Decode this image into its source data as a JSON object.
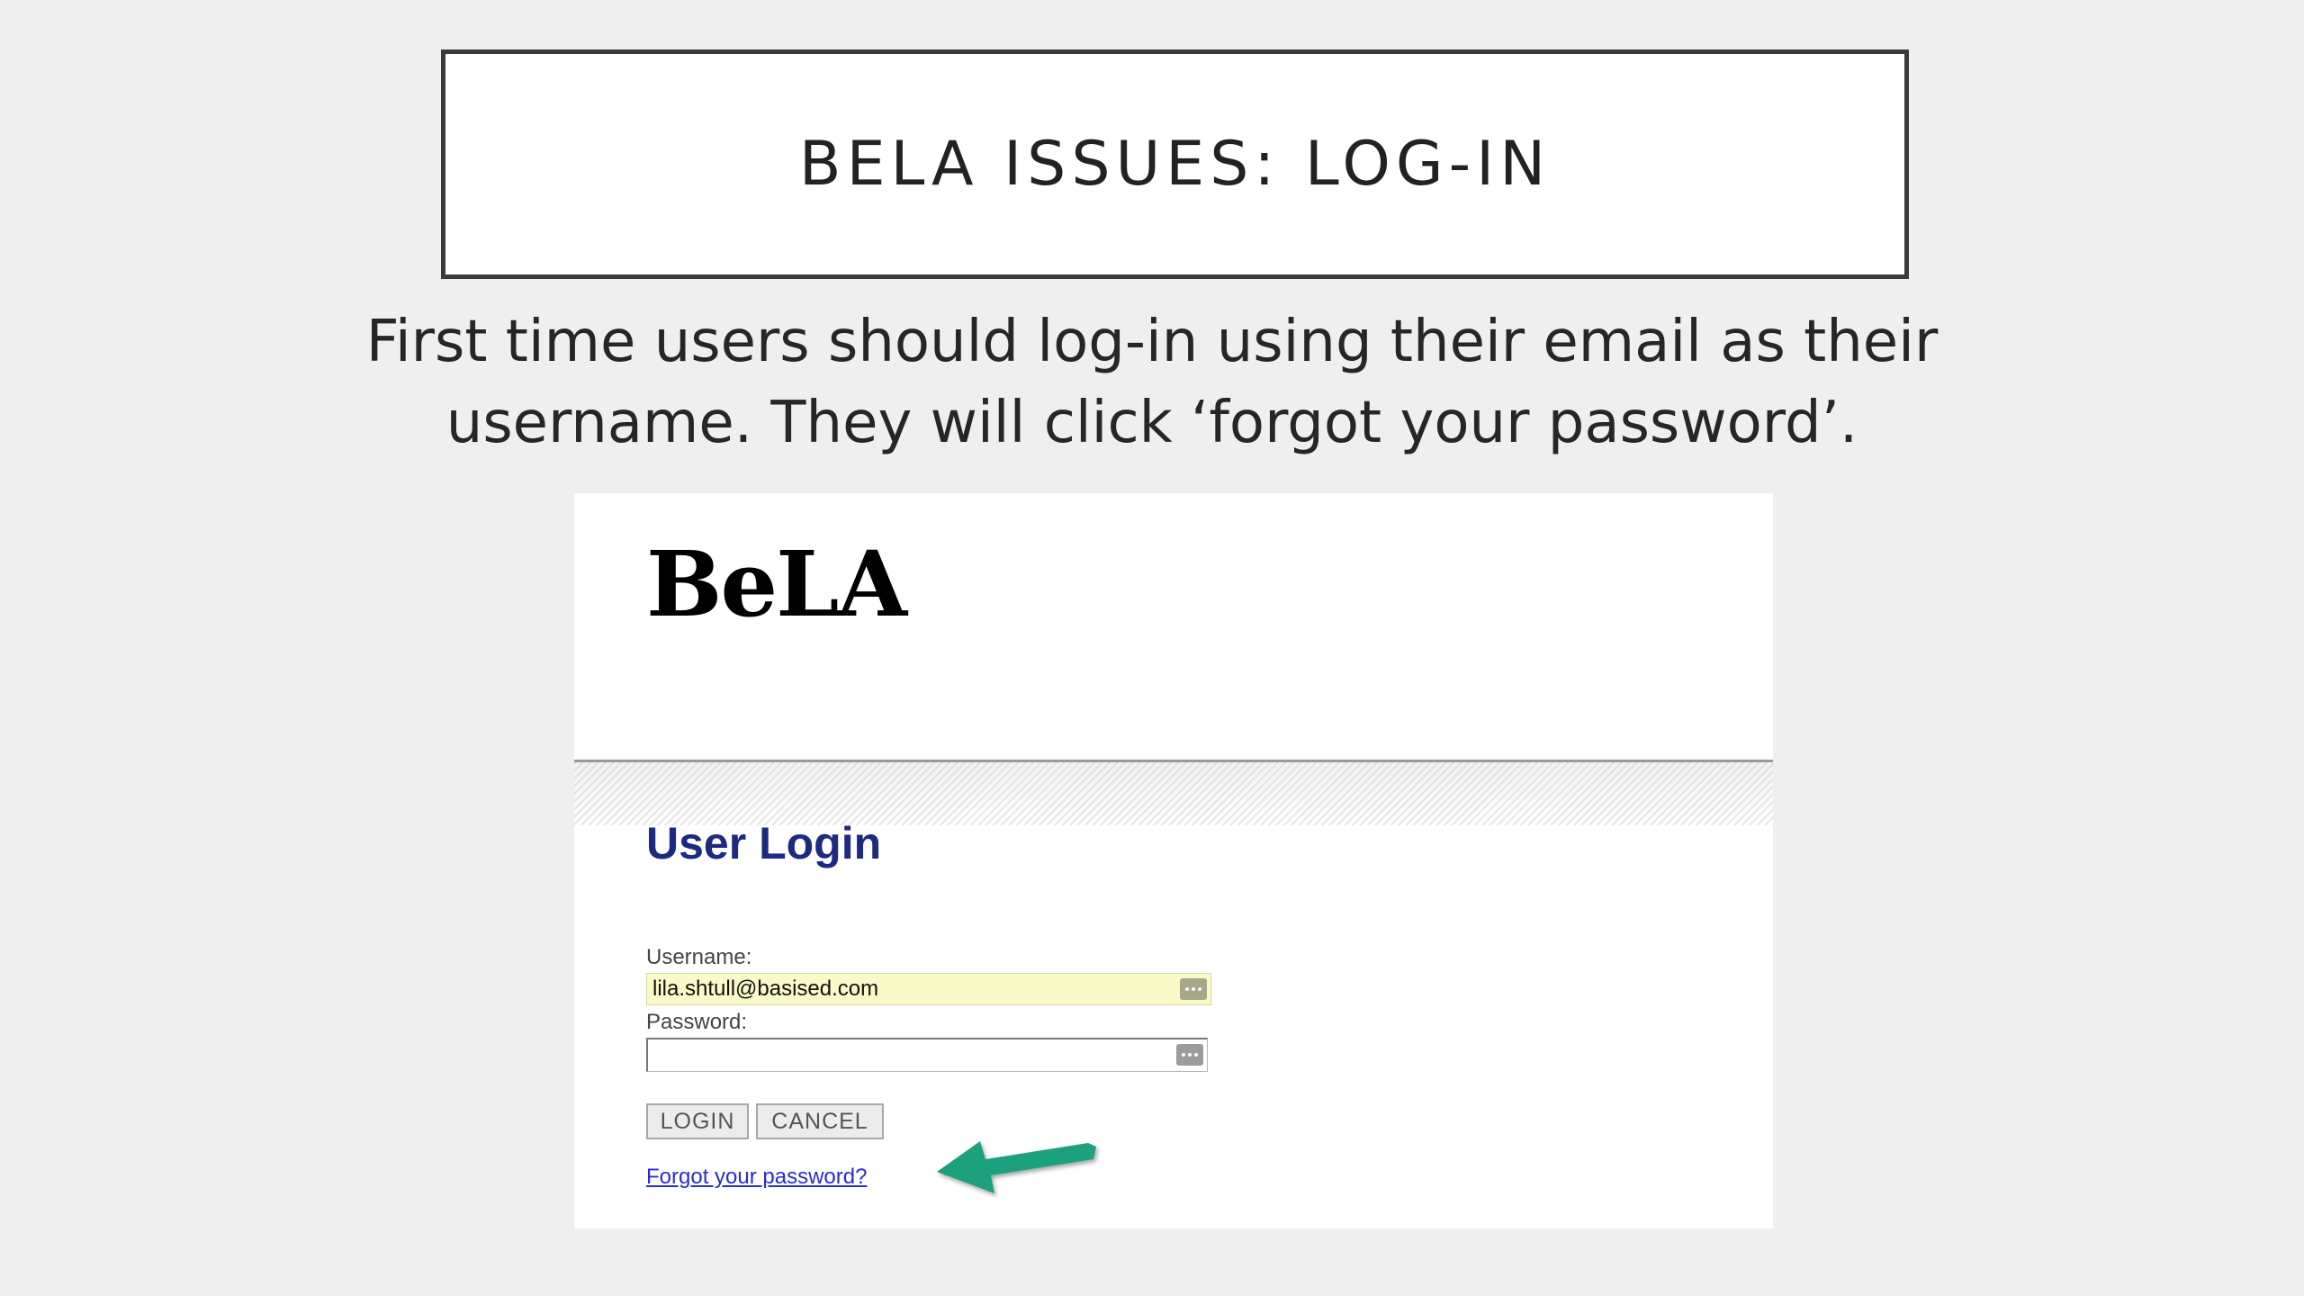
{
  "slide": {
    "title": "BELA ISSUES: LOG-IN",
    "subtitle_line1": "First time users should log-in using their email as their",
    "subtitle_line2": "username. They will click ‘forgot your password’."
  },
  "screenshot": {
    "logo_text": "BeLA",
    "login_title": "User Login",
    "username_label": "Username:",
    "username_value": "lila.shtull@basised.com",
    "password_label": "Password:",
    "password_value": "",
    "login_button": "LOGIN",
    "cancel_button": "CANCEL",
    "forgot_link": "Forgot your password?"
  },
  "icons": {
    "field_menu": "ellipsis-icon",
    "pointer": "arrow-left-icon"
  },
  "colors": {
    "login_title": "#1c2a80",
    "username_field_bg": "#fafac8",
    "link": "#2b2bd0",
    "arrow": "#1aa07e"
  }
}
